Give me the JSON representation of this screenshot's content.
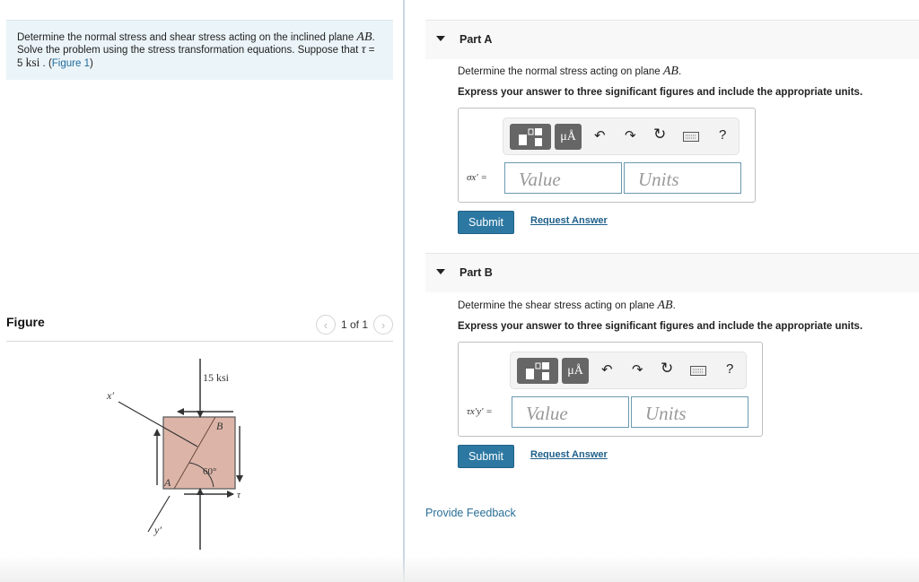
{
  "problem": {
    "text_1": "Determine the normal stress and shear stress acting on the inclined plane ",
    "plane_label": "AB",
    "text_2": ". Solve the problem using the stress transformation equations. Suppose that ",
    "tau_symbol": "τ",
    "tau_eq": " = 5 ",
    "tau_unit": "ksi",
    "text_3": " . (",
    "figure_link": "Figure 1",
    "text_4": ")"
  },
  "figure": {
    "title": "Figure",
    "prev_icon": "chevron-left",
    "next_icon": "chevron-right",
    "counter": "1 of 1",
    "labels": {
      "load": "15 ksi",
      "x_prime": "x′",
      "y_prime": "y′",
      "point_a": "A",
      "point_b": "B",
      "angle": "60°",
      "tau": "τ"
    },
    "colors": {
      "element_fill": "#dcb5a8",
      "line": "#333333"
    }
  },
  "parts": [
    {
      "title": "Part A",
      "question_1": "Determine the normal stress acting on plane ",
      "question_plane": "AB",
      "question_2": ".",
      "instruction": "Express your answer to three significant figures and include the appropriate units.",
      "var_label": "σx′ =",
      "value_placeholder": "Value",
      "units_placeholder": "Units",
      "submit_label": "Submit",
      "request_label": "Request Answer"
    },
    {
      "title": "Part B",
      "question_1": "Determine the shear stress acting on plane ",
      "question_plane": "AB",
      "question_2": ".",
      "instruction": "Express your answer to three significant figures and include the appropriate units.",
      "var_label": "τx′y′ =",
      "value_placeholder": "Value",
      "units_placeholder": "Units",
      "submit_label": "Submit",
      "request_label": "Request Answer"
    }
  ],
  "toolbar": {
    "templates_icon": "templates-icon",
    "units_label": "μÅ",
    "undo_icon": "↶",
    "redo_icon": "↷",
    "reset_icon": "↻",
    "keyboard_icon": "keyboard-icon",
    "help_label": "?"
  },
  "footer": {
    "feedback_label": "Provide Feedback"
  },
  "colors": {
    "accent": "#2c78a2",
    "link": "#1e6a9c",
    "problem_bg": "#ebf4f8"
  }
}
